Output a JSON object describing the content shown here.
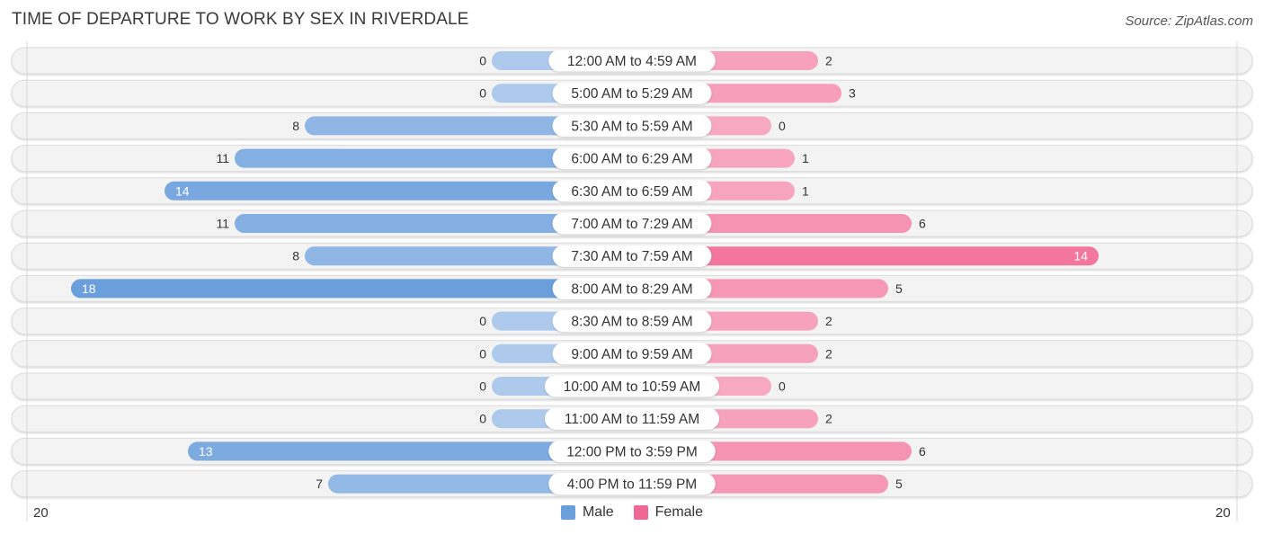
{
  "title": "TIME OF DEPARTURE TO WORK BY SEX IN RIVERDALE",
  "source": "Source: ZipAtlas.com",
  "colors": {
    "male": "#6a9fdc",
    "male_light": "#adc9ec",
    "female": "#f06892",
    "female_light": "#f7a9c2",
    "track": "#f3f3f3"
  },
  "chart_data": {
    "type": "bar",
    "orientation": "horizontal-diverging",
    "title": "TIME OF DEPARTURE TO WORK BY SEX IN RIVERDALE",
    "categories": [
      "12:00 AM to 4:59 AM",
      "5:00 AM to 5:29 AM",
      "5:30 AM to 5:59 AM",
      "6:00 AM to 6:29 AM",
      "6:30 AM to 6:59 AM",
      "7:00 AM to 7:29 AM",
      "7:30 AM to 7:59 AM",
      "8:00 AM to 8:29 AM",
      "8:30 AM to 8:59 AM",
      "9:00 AM to 9:59 AM",
      "10:00 AM to 10:59 AM",
      "11:00 AM to 11:59 AM",
      "12:00 PM to 3:59 PM",
      "4:00 PM to 11:59 PM"
    ],
    "series": [
      {
        "name": "Male",
        "values": [
          0,
          0,
          8,
          11,
          14,
          11,
          8,
          18,
          0,
          0,
          0,
          0,
          13,
          7
        ]
      },
      {
        "name": "Female",
        "values": [
          2,
          3,
          0,
          1,
          1,
          6,
          14,
          5,
          2,
          2,
          0,
          2,
          6,
          5
        ]
      }
    ],
    "xlim": [
      20,
      20
    ],
    "axis_tick_left": "20",
    "axis_tick_right": "20",
    "legend": [
      "Male",
      "Female"
    ],
    "legend_position": "bottom-center"
  }
}
